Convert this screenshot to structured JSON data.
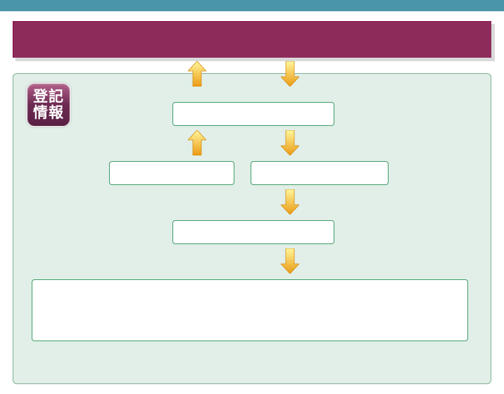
{
  "logo": {
    "line1": "登記",
    "line2": "情報"
  },
  "boxes": {
    "box1": "",
    "box2": "",
    "box3": "",
    "box4": "",
    "box5": ""
  },
  "colors": {
    "header_band": "#8d2c5a",
    "panel_bg": "#e1efe8",
    "panel_border": "#7fb08f",
    "box_border": "#3f9c67",
    "top_bar": "#4a95a7",
    "arrow_start": "#fff79a",
    "arrow_end": "#eb9a14"
  }
}
